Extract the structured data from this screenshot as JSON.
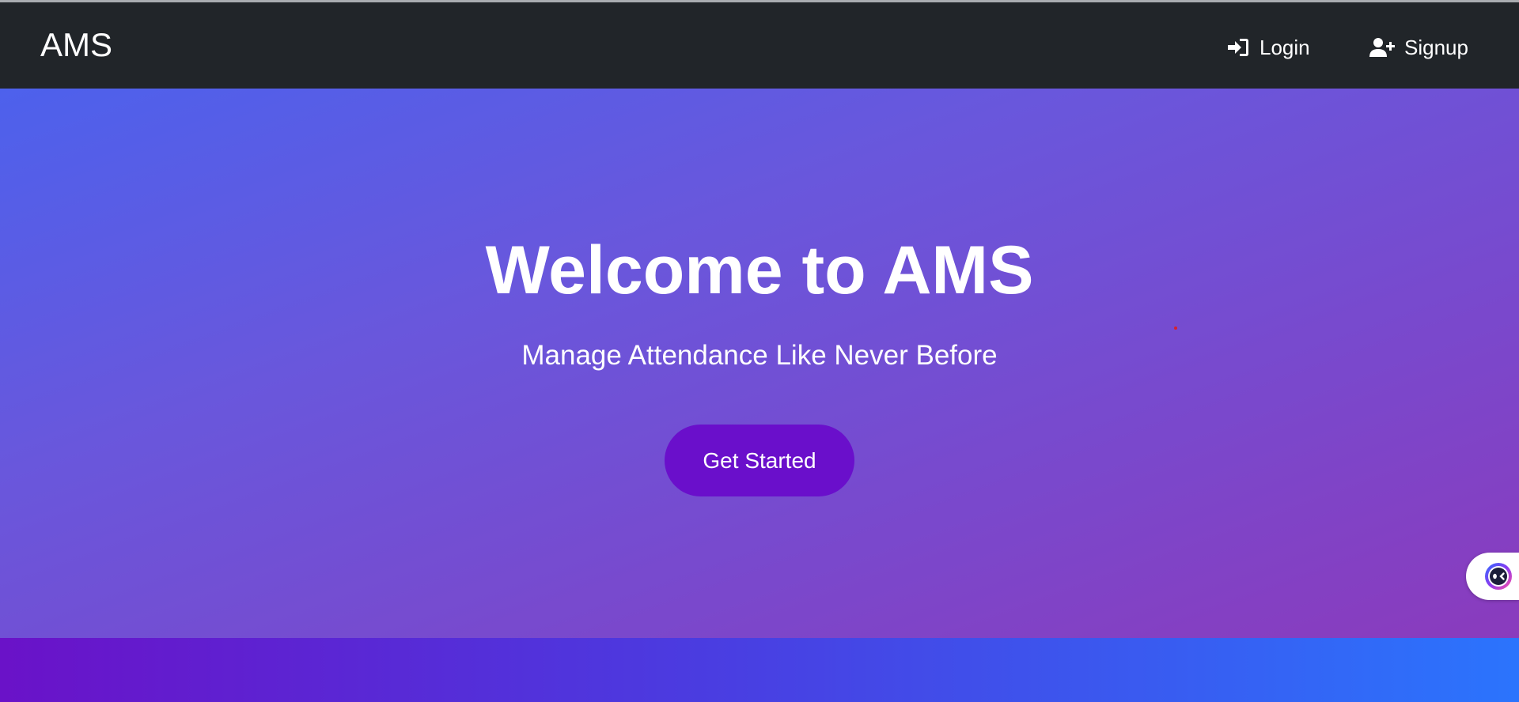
{
  "navbar": {
    "brand": "AMS",
    "login_label": "Login",
    "signup_label": "Signup",
    "login_icon": "sign-in-icon",
    "signup_icon": "user-plus-icon",
    "background": "#212529"
  },
  "hero": {
    "title": "Welcome to AMS",
    "subtitle": "Manage Attendance Like Never Before",
    "cta_label": "Get Started",
    "gradient_colors": [
      "#4d61ec",
      "#8a3bbd"
    ],
    "cta_color": "#6a0fcb"
  },
  "floating": {
    "assistant_icon": "assistant-face-icon"
  },
  "footer": {
    "gradient_colors": [
      "#6a12c8",
      "#4b3be0",
      "#2b74fd"
    ]
  }
}
